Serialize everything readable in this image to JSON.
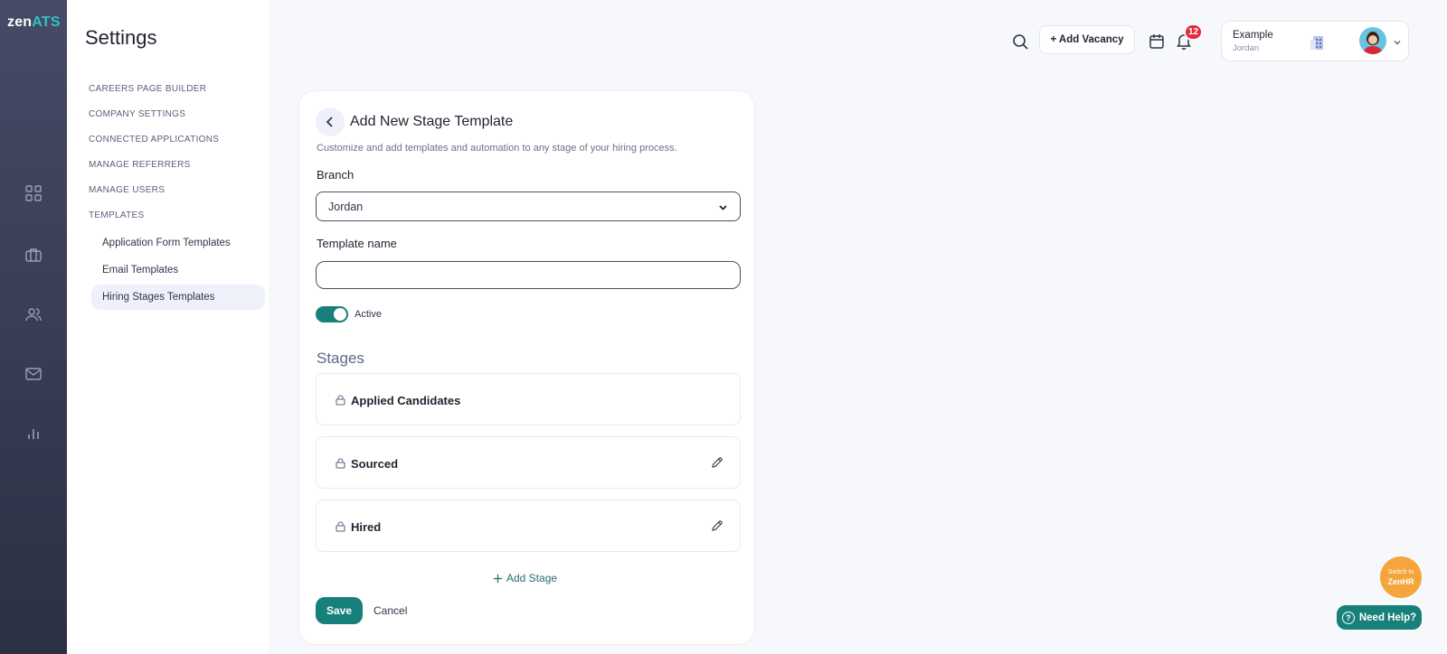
{
  "app": {
    "logo_main": "zen",
    "logo_accent": "ATS"
  },
  "settings_nav": {
    "title": "Settings",
    "items": [
      {
        "label": "CAREERS PAGE BUILDER"
      },
      {
        "label": "COMPANY SETTINGS"
      },
      {
        "label": "CONNECTED APPLICATIONS"
      },
      {
        "label": "MANAGE REFERRERS"
      },
      {
        "label": "MANAGE USERS"
      },
      {
        "label": "TEMPLATES"
      }
    ],
    "sub_items": [
      {
        "label": "Application Form Templates"
      },
      {
        "label": "Email Templates"
      },
      {
        "label": "Hiring Stages Templates"
      }
    ]
  },
  "header": {
    "add_vacancy_label": "+ Add Vacancy",
    "notification_count": "12",
    "company_name": "Example",
    "company_sub": "Jordan"
  },
  "form": {
    "title": "Add New Stage Template",
    "description": "Customize and add templates and automation to any stage of your hiring process.",
    "branch_label": "Branch",
    "branch_value": "Jordan",
    "template_name_label": "Template name",
    "template_name_value": "",
    "active_label": "Active",
    "active": true,
    "stages_heading": "Stages",
    "stages": [
      {
        "name": "Applied Candidates",
        "editable": false
      },
      {
        "name": "Sourced",
        "editable": true
      },
      {
        "name": "Hired",
        "editable": true
      }
    ],
    "add_stage_label": "Add Stage",
    "save_label": "Save",
    "cancel_label": "Cancel"
  },
  "floating": {
    "switch_line1": "Switch to",
    "switch_line2": "ZenHR",
    "help_label": "Need Help?"
  },
  "colors": {
    "rail": "#3a3e56",
    "primary": "#17807a",
    "badge": "#e02a3d",
    "switch": "#f5a53b"
  }
}
